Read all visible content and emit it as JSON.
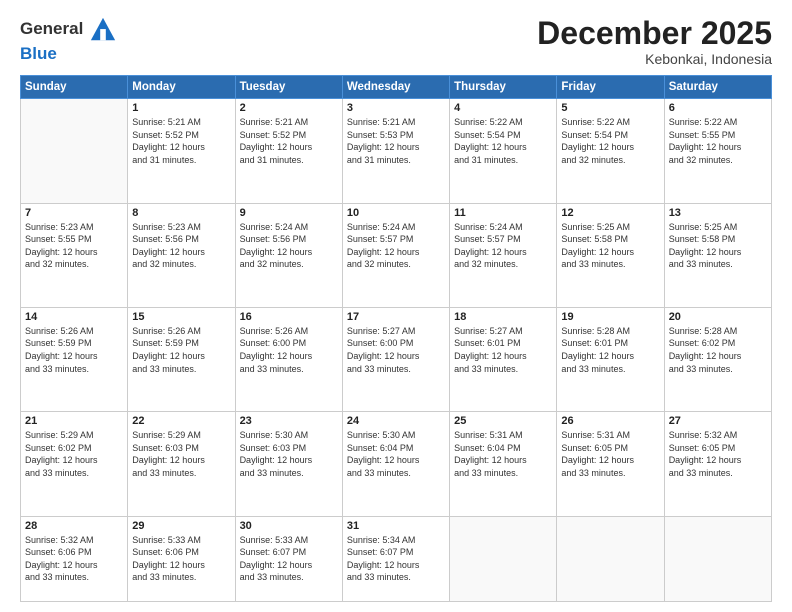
{
  "header": {
    "logo_general": "General",
    "logo_blue": "Blue",
    "month": "December 2025",
    "location": "Kebonkai, Indonesia"
  },
  "weekdays": [
    "Sunday",
    "Monday",
    "Tuesday",
    "Wednesday",
    "Thursday",
    "Friday",
    "Saturday"
  ],
  "weeks": [
    [
      {
        "day": "",
        "info": ""
      },
      {
        "day": "1",
        "info": "Sunrise: 5:21 AM\nSunset: 5:52 PM\nDaylight: 12 hours\nand 31 minutes."
      },
      {
        "day": "2",
        "info": "Sunrise: 5:21 AM\nSunset: 5:52 PM\nDaylight: 12 hours\nand 31 minutes."
      },
      {
        "day": "3",
        "info": "Sunrise: 5:21 AM\nSunset: 5:53 PM\nDaylight: 12 hours\nand 31 minutes."
      },
      {
        "day": "4",
        "info": "Sunrise: 5:22 AM\nSunset: 5:54 PM\nDaylight: 12 hours\nand 31 minutes."
      },
      {
        "day": "5",
        "info": "Sunrise: 5:22 AM\nSunset: 5:54 PM\nDaylight: 12 hours\nand 32 minutes."
      },
      {
        "day": "6",
        "info": "Sunrise: 5:22 AM\nSunset: 5:55 PM\nDaylight: 12 hours\nand 32 minutes."
      }
    ],
    [
      {
        "day": "7",
        "info": "Sunrise: 5:23 AM\nSunset: 5:55 PM\nDaylight: 12 hours\nand 32 minutes."
      },
      {
        "day": "8",
        "info": "Sunrise: 5:23 AM\nSunset: 5:56 PM\nDaylight: 12 hours\nand 32 minutes."
      },
      {
        "day": "9",
        "info": "Sunrise: 5:24 AM\nSunset: 5:56 PM\nDaylight: 12 hours\nand 32 minutes."
      },
      {
        "day": "10",
        "info": "Sunrise: 5:24 AM\nSunset: 5:57 PM\nDaylight: 12 hours\nand 32 minutes."
      },
      {
        "day": "11",
        "info": "Sunrise: 5:24 AM\nSunset: 5:57 PM\nDaylight: 12 hours\nand 32 minutes."
      },
      {
        "day": "12",
        "info": "Sunrise: 5:25 AM\nSunset: 5:58 PM\nDaylight: 12 hours\nand 33 minutes."
      },
      {
        "day": "13",
        "info": "Sunrise: 5:25 AM\nSunset: 5:58 PM\nDaylight: 12 hours\nand 33 minutes."
      }
    ],
    [
      {
        "day": "14",
        "info": "Sunrise: 5:26 AM\nSunset: 5:59 PM\nDaylight: 12 hours\nand 33 minutes."
      },
      {
        "day": "15",
        "info": "Sunrise: 5:26 AM\nSunset: 5:59 PM\nDaylight: 12 hours\nand 33 minutes."
      },
      {
        "day": "16",
        "info": "Sunrise: 5:26 AM\nSunset: 6:00 PM\nDaylight: 12 hours\nand 33 minutes."
      },
      {
        "day": "17",
        "info": "Sunrise: 5:27 AM\nSunset: 6:00 PM\nDaylight: 12 hours\nand 33 minutes."
      },
      {
        "day": "18",
        "info": "Sunrise: 5:27 AM\nSunset: 6:01 PM\nDaylight: 12 hours\nand 33 minutes."
      },
      {
        "day": "19",
        "info": "Sunrise: 5:28 AM\nSunset: 6:01 PM\nDaylight: 12 hours\nand 33 minutes."
      },
      {
        "day": "20",
        "info": "Sunrise: 5:28 AM\nSunset: 6:02 PM\nDaylight: 12 hours\nand 33 minutes."
      }
    ],
    [
      {
        "day": "21",
        "info": "Sunrise: 5:29 AM\nSunset: 6:02 PM\nDaylight: 12 hours\nand 33 minutes."
      },
      {
        "day": "22",
        "info": "Sunrise: 5:29 AM\nSunset: 6:03 PM\nDaylight: 12 hours\nand 33 minutes."
      },
      {
        "day": "23",
        "info": "Sunrise: 5:30 AM\nSunset: 6:03 PM\nDaylight: 12 hours\nand 33 minutes."
      },
      {
        "day": "24",
        "info": "Sunrise: 5:30 AM\nSunset: 6:04 PM\nDaylight: 12 hours\nand 33 minutes."
      },
      {
        "day": "25",
        "info": "Sunrise: 5:31 AM\nSunset: 6:04 PM\nDaylight: 12 hours\nand 33 minutes."
      },
      {
        "day": "26",
        "info": "Sunrise: 5:31 AM\nSunset: 6:05 PM\nDaylight: 12 hours\nand 33 minutes."
      },
      {
        "day": "27",
        "info": "Sunrise: 5:32 AM\nSunset: 6:05 PM\nDaylight: 12 hours\nand 33 minutes."
      }
    ],
    [
      {
        "day": "28",
        "info": "Sunrise: 5:32 AM\nSunset: 6:06 PM\nDaylight: 12 hours\nand 33 minutes."
      },
      {
        "day": "29",
        "info": "Sunrise: 5:33 AM\nSunset: 6:06 PM\nDaylight: 12 hours\nand 33 minutes."
      },
      {
        "day": "30",
        "info": "Sunrise: 5:33 AM\nSunset: 6:07 PM\nDaylight: 12 hours\nand 33 minutes."
      },
      {
        "day": "31",
        "info": "Sunrise: 5:34 AM\nSunset: 6:07 PM\nDaylight: 12 hours\nand 33 minutes."
      },
      {
        "day": "",
        "info": ""
      },
      {
        "day": "",
        "info": ""
      },
      {
        "day": "",
        "info": ""
      }
    ]
  ]
}
